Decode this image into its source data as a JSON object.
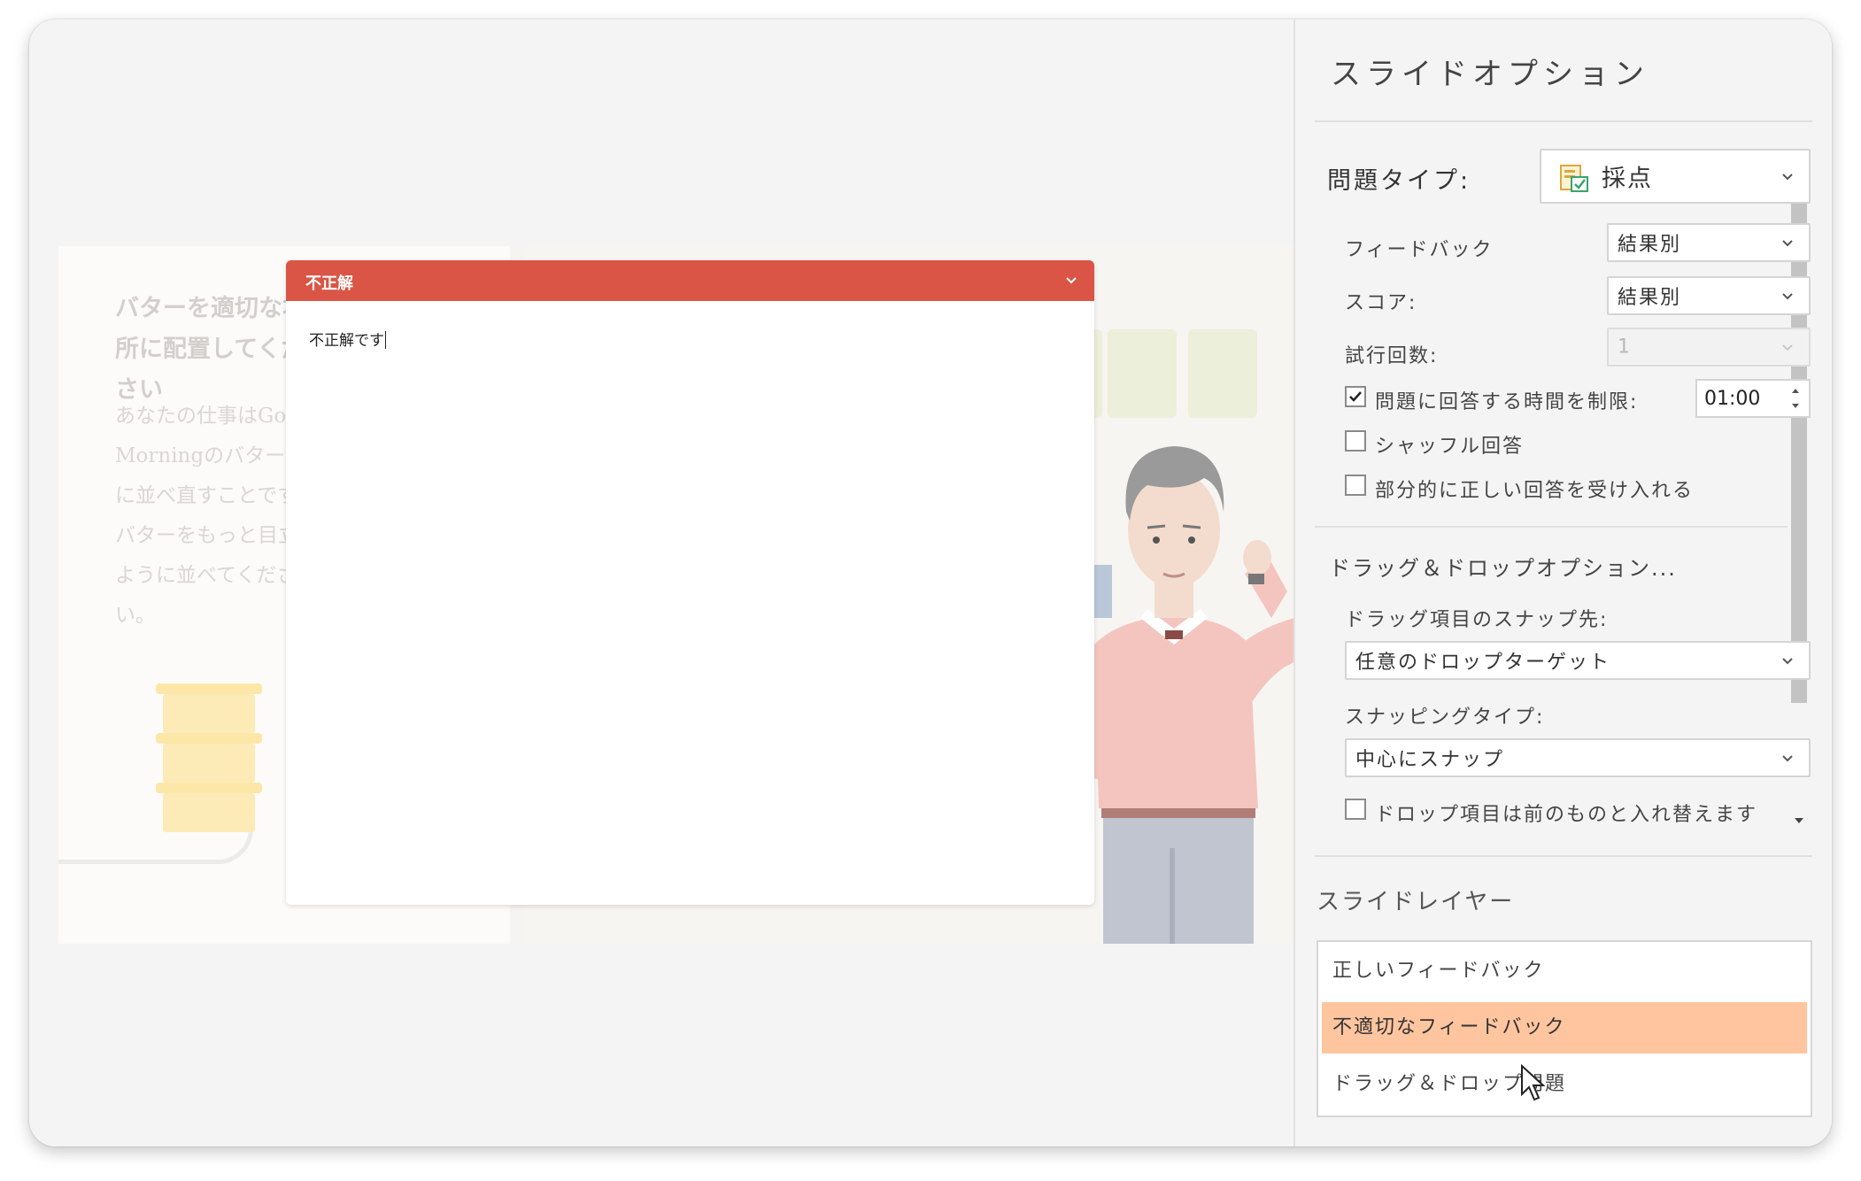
{
  "slide": {
    "title": "バターを適切な場所に配置してください",
    "body": "あなたの仕事はGood Morningのバターを棚に並べ直すことです。バターをもっと目立つように並べてください。"
  },
  "dialog": {
    "title": "不正解",
    "text": "不正解です"
  },
  "panel": {
    "title": "スライドオプション",
    "question_type_label": "問題タイプ:",
    "question_type_value": "採点",
    "feedback_label": "フィードバック",
    "feedback_value": "結果別",
    "score_label": "スコア:",
    "score_value": "結果別",
    "attempts_label": "試行回数:",
    "attempts_value": "1",
    "time_limit_label": "問題に回答する時間を制限:",
    "time_limit_checked": true,
    "time_limit_value": "01:00",
    "shuffle_label": "シャッフル回答",
    "partial_label": "部分的に正しい回答を受け入れる",
    "dnd_section_label": "ドラッグ＆ドロップオプション...",
    "snap_to_label": "ドラッグ項目のスナップ先:",
    "snap_to_value": "任意のドロップターゲット",
    "snapping_type_label": "スナッピングタイプ:",
    "snapping_type_value": "中心にスナップ",
    "replace_label": "ドロップ項目は前のものと入れ替えます",
    "layers_label": "スライドレイヤー",
    "layers": [
      "正しいフィードバック",
      "不適切なフィードバック",
      "ドラッグ＆ドロップ問題"
    ]
  },
  "colors": {
    "dialog_header": "#da5545",
    "selected_layer": "#ffc59f",
    "sweater": "#f4c5be"
  }
}
